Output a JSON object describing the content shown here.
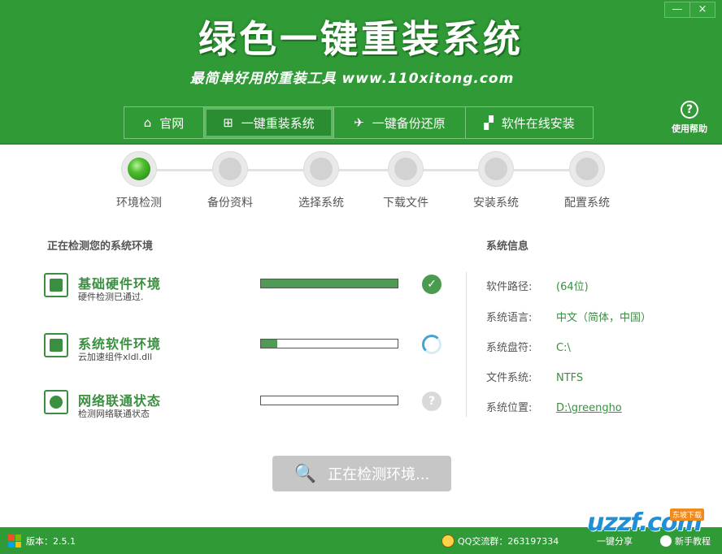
{
  "window": {
    "title": "绿色一键重装系统",
    "subtitle": "最简单好用的重装工具 www.110xitong.com",
    "minimize": "—",
    "close": "×"
  },
  "help": {
    "icon": "?",
    "label": "使用帮助"
  },
  "nav": [
    {
      "label": "官网",
      "icon": "home-icon",
      "glyph": "⌂"
    },
    {
      "label": "一键重装系统",
      "icon": "windows-icon",
      "glyph": "⊞"
    },
    {
      "label": "一键备份还原",
      "icon": "bird-icon",
      "glyph": "✈"
    },
    {
      "label": "软件在线安装",
      "icon": "checker-icon",
      "glyph": "▞"
    }
  ],
  "steps": [
    {
      "label": "环境检测",
      "done": true
    },
    {
      "label": "备份资料",
      "done": false
    },
    {
      "label": "选择系统",
      "done": false
    },
    {
      "label": "下载文件",
      "done": false
    },
    {
      "label": "安装系统",
      "done": false
    },
    {
      "label": "配置系统",
      "done": false
    }
  ],
  "detection": {
    "title": "正在检测您的系统环境",
    "items": [
      {
        "title": "基础硬件环境",
        "sub": "硬件检测已通过.",
        "progress": 1.0,
        "status": "ok",
        "icon": "hardware-icon"
      },
      {
        "title": "系统软件环境",
        "sub": "云加速组件xldl.dll",
        "progress": 0.12,
        "status": "loading",
        "icon": "software-icon"
      },
      {
        "title": "网络联通状态",
        "sub": "检测网络联通状态",
        "progress": 0.0,
        "status": "unknown",
        "icon": "globe-icon"
      }
    ],
    "ok_glyph": "✓",
    "unknown_glyph": "?"
  },
  "sysinfo": {
    "title": "系统信息",
    "rows": [
      {
        "key": "软件路径:",
        "value": "(64位)"
      },
      {
        "key": "系统语言:",
        "value": "中文（简体，中国）"
      },
      {
        "key": "系统盘符:",
        "value": "C:\\"
      },
      {
        "key": "文件系统:",
        "value": "NTFS"
      },
      {
        "key": "系统位置:",
        "value": "D:\\greengho"
      }
    ]
  },
  "detect_button": {
    "label": "正在检测环境...",
    "icon": "search-icon",
    "glyph": "🔍"
  },
  "footer": {
    "version_label": "版本：2.5.1",
    "qq_group": "QQ交流群：263197334",
    "share": "一键分享",
    "tutorial": "新手教程"
  },
  "watermark": {
    "text": "uzzf.com",
    "tag": "东坡下载"
  },
  "colors": {
    "brand_green": "#2f9a36",
    "accent_green": "#3a8f40",
    "button_disabled": "#c6c6c6"
  }
}
